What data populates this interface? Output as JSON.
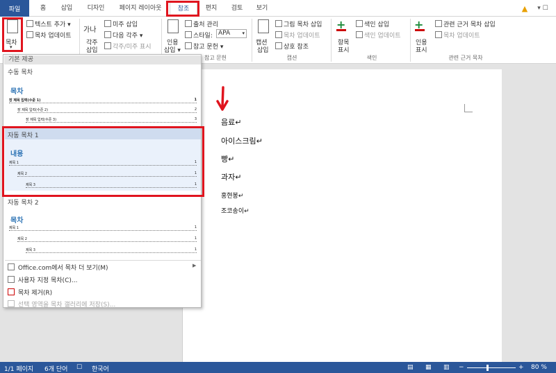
{
  "tabs": {
    "file": "파일",
    "home": "홈",
    "insert": "삽입",
    "design": "디자인",
    "layout": "페이지 레이아웃",
    "references": "참조",
    "mailings": "편지",
    "review": "검토",
    "view": "보기"
  },
  "ribbon": {
    "toc_button": "목차",
    "add_text": "텍스트 추가 ▾",
    "update_toc": "목차 업데이트",
    "footnote_ab": "가나",
    "footnote_label": "각주",
    "footnote_label2": "삽입",
    "insert_endnote": "미주 삽입",
    "next_footnote": "다음 각주 ▾",
    "show_notes": "각주/미주 표시",
    "citation": "인용",
    "citation2": "삽입 ▾",
    "manage_sources": "출처 관리",
    "style_label": "스타일:",
    "style_value": "APA",
    "bibliography": "참고 문헌 ▾",
    "caption": "캡션",
    "caption2": "삽입",
    "insert_tof": "그림 목차 삽입",
    "update_table": "목차 업데이트",
    "cross_ref": "상호 참조",
    "mark_entry": "항목",
    "mark_entry2": "표시",
    "insert_index": "색인 삽입",
    "update_index": "색인 업데이트",
    "mark_citation": "인용",
    "mark_citation2": "표시",
    "insert_toa": "관련 근거 목차 삽입",
    "update_toa": "목차 업데이트",
    "group_citations": "참고 문헌",
    "group_captions": "캡션",
    "group_index": "색인",
    "group_toa": "관련 근거 목차"
  },
  "dropdown": {
    "builtin_header": "기본 제공",
    "manual_toc": "수동 목차",
    "toc_title": "목차",
    "manual_rows": [
      "장 제목 입력(수준 1)",
      "장 제목 입력(수준 2)",
      "장 제목 입력(수준 3)"
    ],
    "manual_nums": [
      "1",
      "2",
      "3"
    ],
    "auto1_label": "자동 목차 1",
    "auto1_title": "내용",
    "auto1_rows": [
      "제목 1",
      "제목 2",
      "제목 3"
    ],
    "auto1_nums": [
      "1",
      "1",
      "1"
    ],
    "auto2_label": "자동 목차 2",
    "auto2_title": "목차",
    "auto2_rows": [
      "제목 1",
      "제목 2",
      "제목 3"
    ],
    "auto2_nums": [
      "1",
      "1",
      "1"
    ],
    "menu_more": "Office.com에서 목차 더 보기(M)",
    "menu_custom": "사용자 지정 목차(C)...",
    "menu_remove": "목차 제거(R)",
    "menu_save": "선택 영역을 목차 갤러리에 저장(S)..."
  },
  "document": {
    "lines": [
      "음료↵",
      "아이스크림↵",
      "빵↵",
      "과자↵",
      "홍현봉↵",
      "조코송이↵"
    ]
  },
  "status": {
    "page": "1/1 페이지",
    "words": "6개 단어",
    "lang": "한국어",
    "zoom": "80 %"
  },
  "colors": {
    "accent": "#2b579a",
    "highlight": "#e0141e",
    "toc_blue": "#2e74b5"
  }
}
